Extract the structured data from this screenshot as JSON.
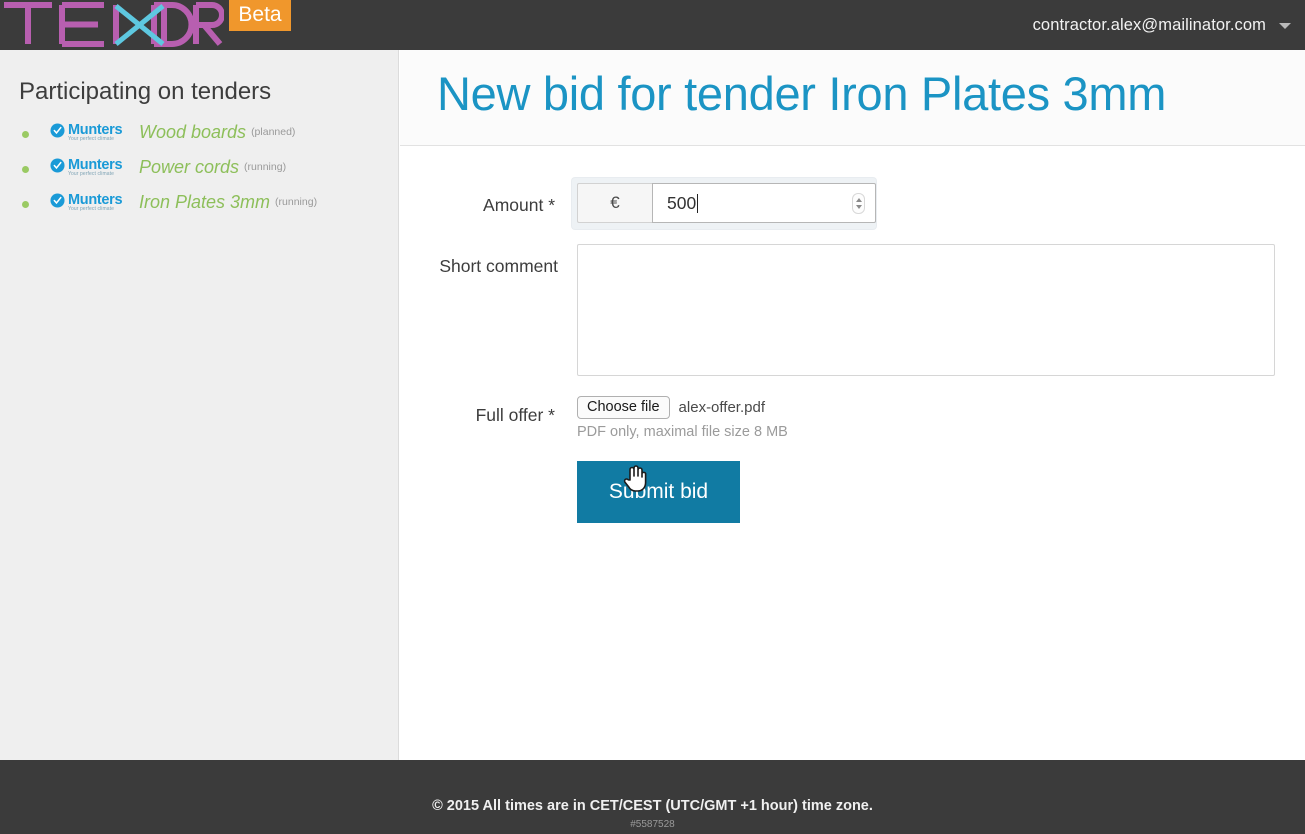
{
  "header": {
    "logo_text": "TENDR",
    "logo_colors": {
      "letters": "#b85fb0",
      "accent": "#5ec8e0"
    },
    "beta_label": "Beta",
    "beta_color": "#f0972c",
    "user_email": "contractor.alex@mailinator.com",
    "caret_icon": "chevron-down-icon",
    "background": "#3b3b3b"
  },
  "sidebar": {
    "title": "Participating on tenders",
    "background": "#efefef",
    "bullet_color": "#8bc34a",
    "items": [
      {
        "brand": "Munters",
        "brand_tagline": "Your perfect climate",
        "name": "Wood boards",
        "status": "(planned)"
      },
      {
        "brand": "Munters",
        "brand_tagline": "Your perfect climate",
        "name": "Power cords",
        "status": "(running)"
      },
      {
        "brand": "Munters",
        "brand_tagline": "Your perfect climate",
        "name": "Iron Plates 3mm",
        "status": "(running)"
      }
    ],
    "name_color": "#8dbf5a",
    "brand_color": "#1a9ad7"
  },
  "main": {
    "page_title": "New bid for tender Iron Plates 3mm",
    "title_color": "#1b94c4",
    "form": {
      "amount": {
        "label": "Amount *",
        "currency_addon": "€",
        "value": "500",
        "placeholder": "",
        "spinner_icon": "number-spinner-icon",
        "focused": "true"
      },
      "comment": {
        "label": "Short comment",
        "value": "",
        "placeholder": ""
      },
      "full_offer": {
        "label": "Full offer *",
        "choose_file_label": "Choose file",
        "file_name": "alex-offer.pdf",
        "hint": "PDF only, maximal file size 8 MB"
      },
      "submit": {
        "label": "Submit bid",
        "color": "#117ba3",
        "cursor_icon": "hand-pointer-cursor"
      }
    }
  },
  "footer": {
    "copyright": "© 2015 All times are in CET/CEST (UTC/GMT +1 hour) time zone.",
    "build": "#5587528",
    "background": "#3b3b3b"
  }
}
